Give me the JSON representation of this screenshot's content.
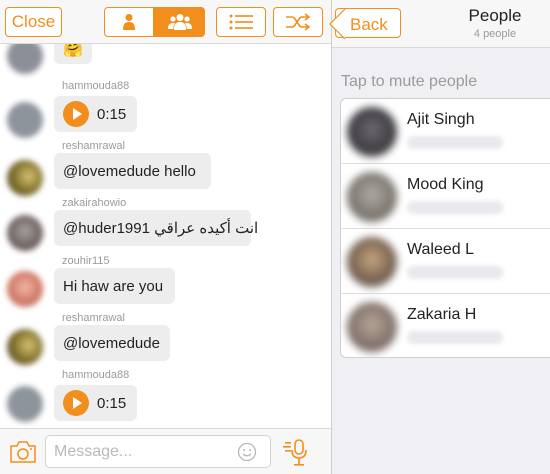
{
  "chat": {
    "toolbar": {
      "close_label": "Close"
    },
    "messages": [
      {
        "username": "",
        "type": "emoji",
        "text": "🤗"
      },
      {
        "username": "hammouda88",
        "type": "audio",
        "duration": "0:15"
      },
      {
        "username": "reshamrawal",
        "type": "text",
        "text": "@lovemedude  hello"
      },
      {
        "username": "zakairahowio",
        "type": "text",
        "text": "@huder1991 انت أكيده عراقي"
      },
      {
        "username": "zouhir115",
        "type": "text",
        "text": "Hi haw are you"
      },
      {
        "username": "reshamrawal",
        "type": "text",
        "text": "@lovemedude"
      },
      {
        "username": "hammouda88",
        "type": "audio",
        "duration": "0:15"
      }
    ],
    "composer": {
      "placeholder": "Message..."
    }
  },
  "people_panel": {
    "back_label": "Back",
    "title": "People",
    "count_label": "4 people",
    "hint": "Tap to mute people",
    "people": [
      {
        "name": "Ajit Singh"
      },
      {
        "name": "Mood King"
      },
      {
        "name": "Waleed L"
      },
      {
        "name": "Zakaria H"
      }
    ]
  },
  "colors": {
    "accent": "#f28e1c",
    "toolbar_bg": "#f7f7f7",
    "bubble_bg": "#ededed",
    "panel_bg": "#efeff4",
    "secondary_text": "#9b9b9b"
  },
  "icons": {
    "seg_person": "person-icon",
    "seg_group": "group-icon",
    "list": "list-icon",
    "shuffle": "shuffle-icon",
    "camera": "camera-icon",
    "emoji": "smiley-icon",
    "voice": "microphone-icon",
    "play": "play-icon"
  }
}
